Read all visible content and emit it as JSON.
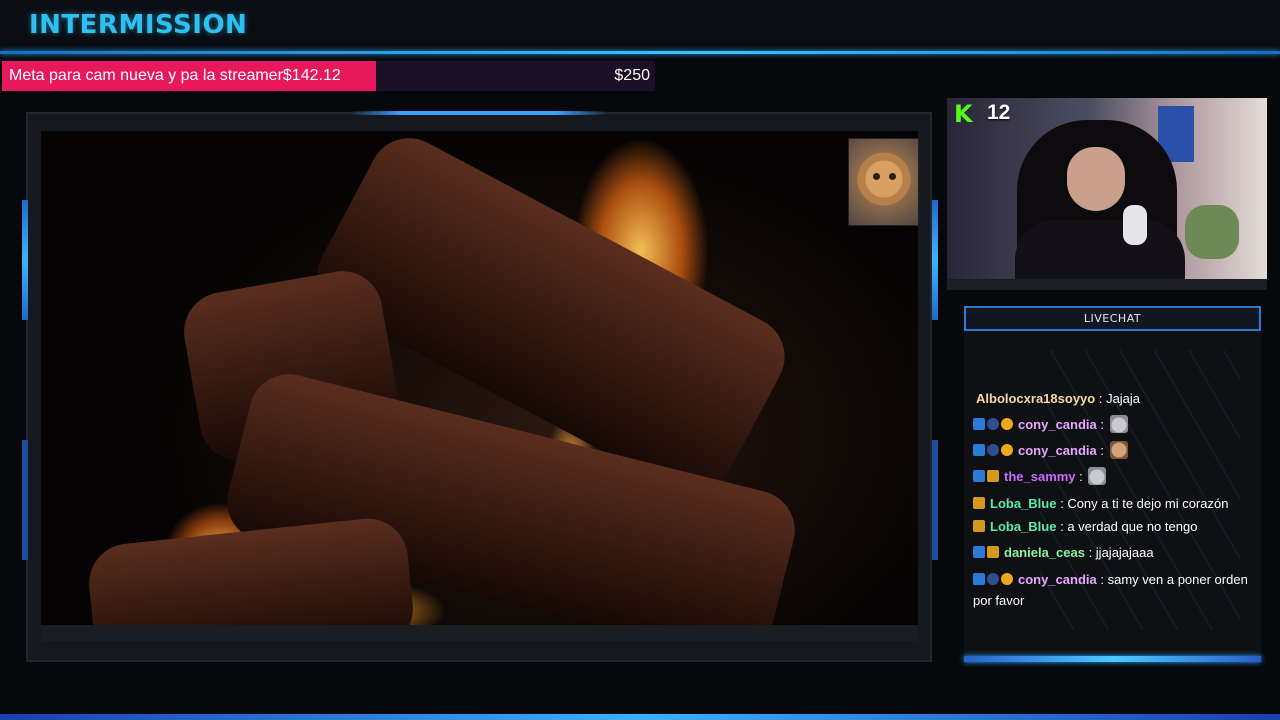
{
  "header": {
    "title": "INTERMISSION"
  },
  "goal": {
    "label": "Meta para cam nueva y pa la streamer$142.12",
    "target": "$250",
    "current_amount": 142.12,
    "target_amount": 250,
    "fill_color": "#e8185d"
  },
  "video": {
    "scene": "fireplace",
    "overlay_icon": "cat-cam-icon"
  },
  "webcam": {
    "platform_icon": "kick-logo-icon",
    "viewer_count": "12"
  },
  "chat": {
    "title": "LIVECHAT",
    "messages": [
      {
        "user": "Albolocxra18soyyo",
        "sep": " : ",
        "text": "Jajaja",
        "color": "#f6d7a5",
        "badges": [],
        "emote": ""
      },
      {
        "user": "cony_candia",
        "sep": " : ",
        "text": "",
        "color": "#e9a6ff",
        "badges": [
          "prime",
          "sub",
          "coin"
        ],
        "emote": "cat-emote-icon"
      },
      {
        "user": "cony_candia",
        "sep": " : ",
        "text": "",
        "color": "#e9a6ff",
        "badges": [
          "prime",
          "sub",
          "coin"
        ],
        "emote": "face-emote-icon"
      },
      {
        "user": "the_sammy",
        "sep": " : ",
        "text": "",
        "color": "#c86aff",
        "badges": [
          "prime",
          "crown"
        ],
        "emote": "cat-emote-icon"
      },
      {
        "user": "Loba_Blue",
        "sep": " : ",
        "text": "Cony a ti te dejo mi corazón",
        "color": "#5ee9b0",
        "badges": [
          "crown"
        ],
        "emote": ""
      },
      {
        "user": "Loba_Blue",
        "sep": " : ",
        "text": "a verdad que no tengo",
        "color": "#5ee9b0",
        "badges": [
          "crown"
        ],
        "emote": ""
      },
      {
        "user": "daniela_ceas",
        "sep": " : ",
        "text": "jjajajajaaa",
        "color": "#8ef39c",
        "badges": [
          "prime",
          "crown"
        ],
        "emote": ""
      },
      {
        "user": "cony_candia",
        "sep": " : ",
        "text": "samy ven a poner orden por favor",
        "color": "#e9a6ff",
        "badges": [
          "prime",
          "sub",
          "coin"
        ],
        "emote": ""
      }
    ]
  }
}
